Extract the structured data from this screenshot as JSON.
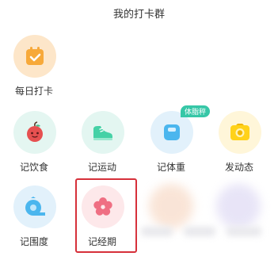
{
  "header": {
    "title": "我的打卡群"
  },
  "tiles": [
    {
      "label": "每日打卡",
      "icon": "calendar-check-icon",
      "bg": "#fde6c9",
      "fg": "#f7a93a"
    },
    {
      "label": "记饮食",
      "icon": "apple-icon",
      "bg": "#e4f6f1",
      "fg": "#e65050"
    },
    {
      "label": "记运动",
      "icon": "sneaker-icon",
      "bg": "#e3f6f1",
      "fg": "#45d1a6"
    },
    {
      "label": "记体重",
      "icon": "scale-icon",
      "bg": "#e2f1fb",
      "fg": "#4bb6ee",
      "badge": "体脂秤"
    },
    {
      "label": "发动态",
      "icon": "camera-icon",
      "bg": "#fff6d9",
      "fg": "#ffd21a"
    },
    {
      "label": "记围度",
      "icon": "tape-measure-icon",
      "bg": "#e2f1fb",
      "fg": "#4bb6ee"
    },
    {
      "label": "记经期",
      "icon": "flower-icon",
      "bg": "#fde8ea",
      "fg": "#ef6f83"
    }
  ]
}
